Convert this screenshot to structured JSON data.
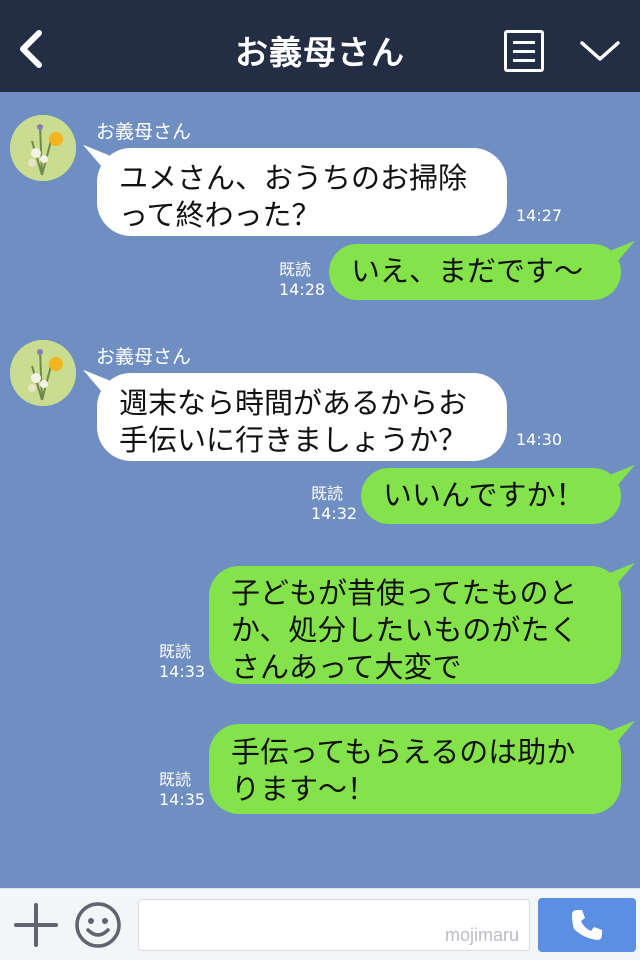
{
  "header": {
    "title": "お義母さん",
    "icons": {
      "back": "back-chevron-icon",
      "menu": "menu-list-icon",
      "collapse": "chevron-down-icon"
    }
  },
  "messages": [
    {
      "type": "incoming",
      "sender": "お義母さん",
      "lines": [
        "ユメさん、おうちのお掃除",
        "って終わった？"
      ],
      "time": "14:27"
    },
    {
      "type": "outgoing",
      "read": "既読",
      "lines": [
        "いえ、まだです〜"
      ],
      "time": "14:28"
    },
    {
      "type": "incoming",
      "sender": "お義母さん",
      "lines": [
        "週末なら時間があるからお",
        "手伝いに行きましょうか？"
      ],
      "time": "14:30"
    },
    {
      "type": "outgoing",
      "read": "既読",
      "lines": [
        "いいんですか！"
      ],
      "time": "14:32"
    },
    {
      "type": "outgoing",
      "read": "既読",
      "lines": [
        "子どもが昔使ってたものと",
        "か、処分したいものがたく",
        "さんあって大変で"
      ],
      "time": "14:33"
    },
    {
      "type": "outgoing",
      "read": "既読",
      "lines": [
        "手伝ってもらえるのは助か",
        "ります〜！"
      ],
      "time": "14:35"
    }
  ],
  "footer": {
    "input_value": "",
    "watermark": "mojimaru",
    "icons": {
      "add": "plus-icon",
      "emoji": "smiley-icon",
      "call": "phone-icon"
    }
  },
  "colors": {
    "header_bg": "#232d44",
    "chat_bg": "#6f8fc2",
    "incoming_bubble": "#ffffff",
    "outgoing_bubble": "#84e34a",
    "call_button": "#5b8fe3"
  }
}
